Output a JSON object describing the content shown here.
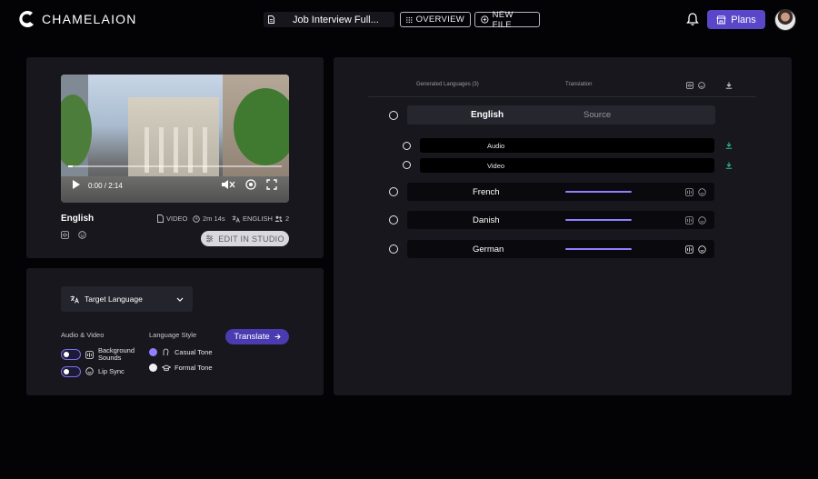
{
  "app": {
    "name": "CHAMELAION"
  },
  "header": {
    "file_title": "Job Interview Full...",
    "overview_label": "OVERVIEW",
    "new_file_label": "NEW FILE",
    "plans_label": "Plans"
  },
  "video_panel": {
    "time": "0:00 / 2:14",
    "progress": 0.02,
    "title": "English",
    "type": "VIDEO",
    "duration": "2m 14s",
    "language": "ENGLISH",
    "speakers": "2",
    "edit_label": "EDIT IN STUDIO"
  },
  "settings": {
    "target_language_label": "Target Language",
    "audio_video_label": "Audio & Video",
    "background_sounds_label": "Background Sounds",
    "lip_sync_label": "Lip Sync",
    "language_style_label": "Language Style",
    "casual_label": "Casual Tone",
    "formal_label": "Formal Tone",
    "translate_label": "Translate"
  },
  "languages": {
    "header_generated": "Generated Languages (3)",
    "header_translation": "Translation",
    "source": {
      "name": "English",
      "tag": "Source",
      "audio_label": "Audio",
      "video_label": "Video"
    },
    "items": [
      {
        "name": "French",
        "progress": 1.0
      },
      {
        "name": "Danish",
        "progress": 1.0
      },
      {
        "name": "German",
        "progress": 1.0
      }
    ]
  },
  "colors": {
    "accent": "#8f80ff",
    "plans": "#5a46c8",
    "download": "#2fbfa0"
  },
  "icons": [
    "file-icon",
    "grid-icon",
    "plus-circle-icon",
    "bell-icon",
    "store-icon",
    "play-icon",
    "volume-icon",
    "fullscreen-icon",
    "clock-icon",
    "translate-icon",
    "users-icon",
    "sliders-icon",
    "chevron-down-icon",
    "arrow-right-icon",
    "download-icon",
    "smile-icon",
    "sound-wave-icon"
  ]
}
